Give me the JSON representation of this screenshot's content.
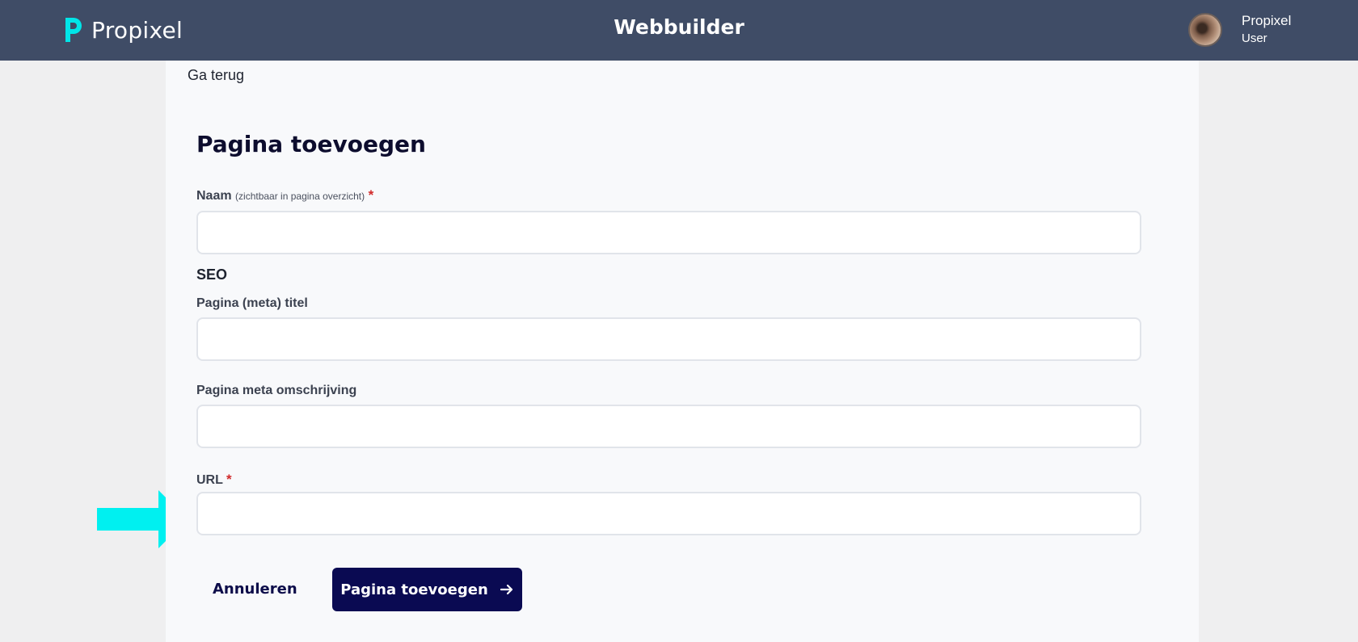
{
  "header": {
    "logo_text": "Propixel",
    "app_title": "Webbuilder",
    "user_name": "Propixel",
    "user_role": "User",
    "brand_color": "#3f4c66",
    "logo_accent": "#00e5e8"
  },
  "nav": {
    "back_label": "Ga terug"
  },
  "form": {
    "title": "Pagina toevoegen",
    "name": {
      "label": "Naam",
      "hint": "(zichtbaar in pagina overzicht)",
      "required_mark": "*",
      "value": ""
    },
    "seo_heading": "SEO",
    "meta_title": {
      "label": "Pagina (meta) titel",
      "value": ""
    },
    "meta_description": {
      "label": "Pagina meta omschrijving",
      "value": ""
    },
    "url": {
      "label": "URL",
      "required_mark": "*",
      "value": ""
    },
    "cancel_label": "Annuleren",
    "submit_label": "Pagina toevoegen",
    "submit_color": "#0a0a52"
  },
  "annotation": {
    "arrow_color": "#00f0f0",
    "icon": "right-arrow-pointer"
  }
}
